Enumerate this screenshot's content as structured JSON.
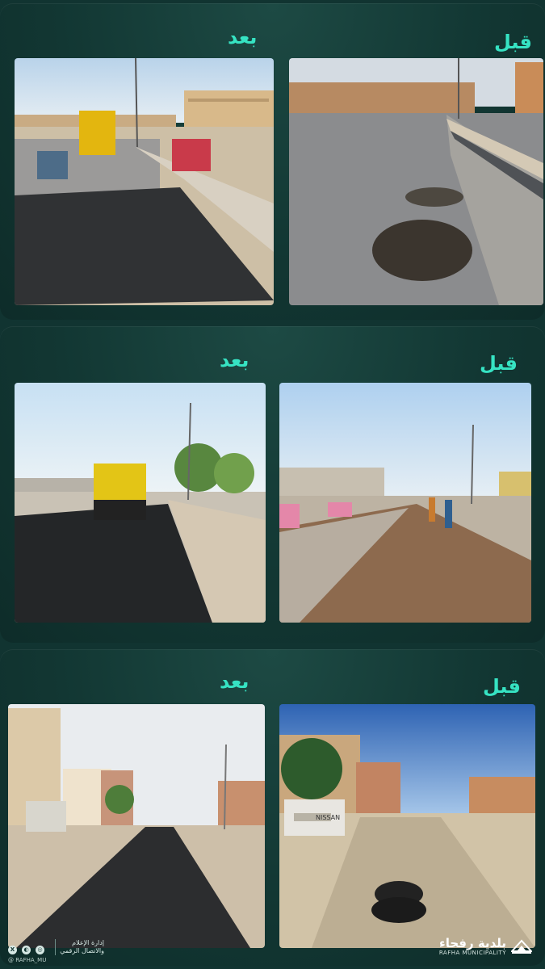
{
  "rows": [
    {
      "after_label": "بعد",
      "before_label": "قبل"
    },
    {
      "after_label": "بعد",
      "before_label": "قبل"
    },
    {
      "after_label": "بعد",
      "before_label": "قبل"
    }
  ],
  "photos": {
    "r1_before": {
      "plate": ""
    },
    "r3_before": {
      "truck_brand": "NISSAN"
    }
  },
  "footer": {
    "department_line1": "إدارة الإعلام",
    "department_line2": "والاتصال الرقمي",
    "handle": "@ RAFHA_MU",
    "brand_ar": "بلدية رفحاء",
    "brand_en": "RAFHA MUNICIPALITY"
  },
  "colors": {
    "accent": "#36e3c3",
    "background": "#113431"
  }
}
